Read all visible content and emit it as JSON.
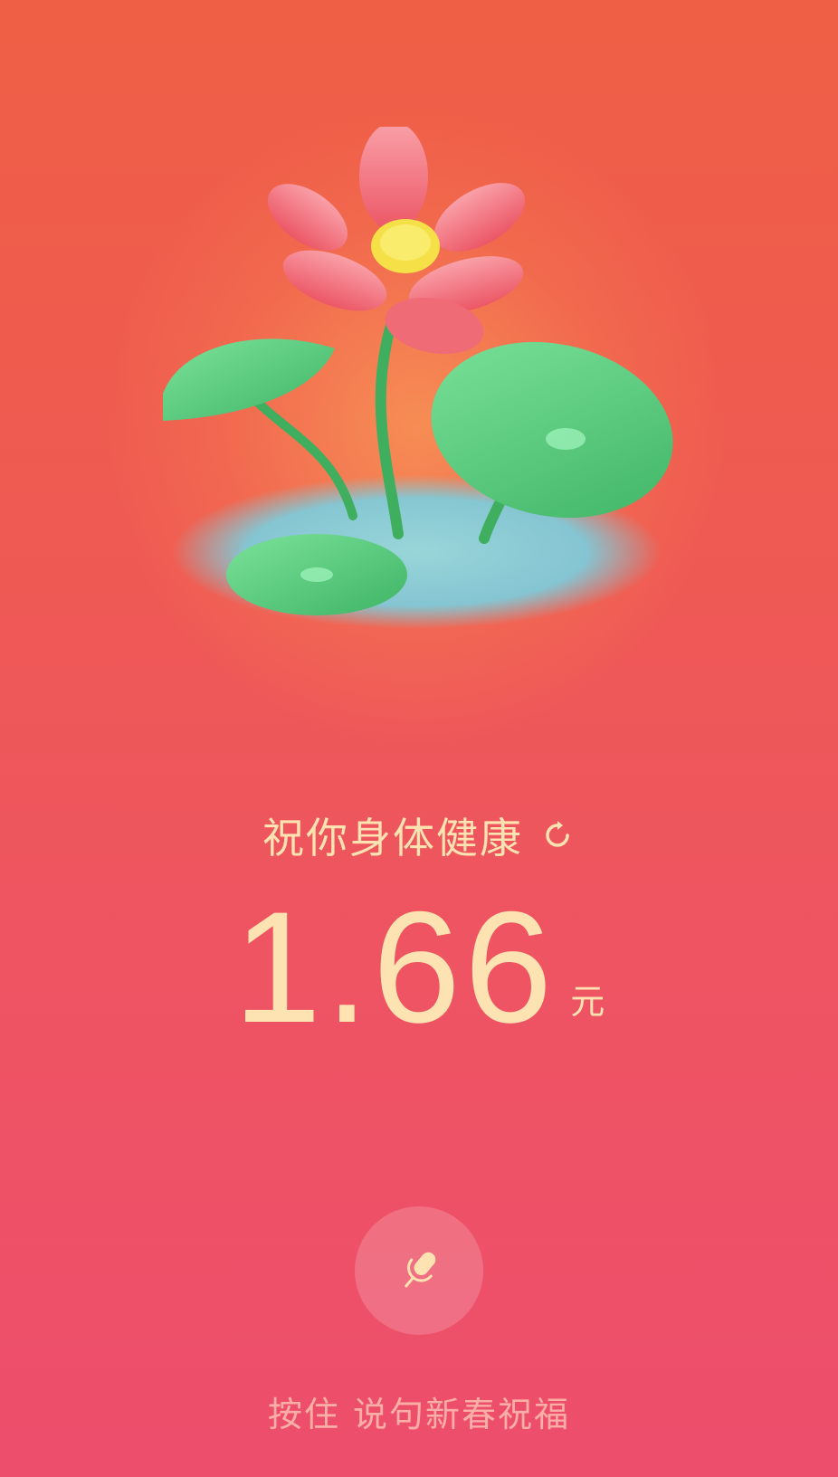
{
  "blessing": {
    "text": "祝你身体健康",
    "refresh_icon": "refresh-icon"
  },
  "amount": {
    "value": "1.66",
    "currency": "元"
  },
  "voice": {
    "icon": "microphone-icon",
    "hint": "按住 说句新春祝福"
  },
  "colors": {
    "background_top": "#ef5f45",
    "background_bottom": "#ed4e6c",
    "text_gold": "#fde3b2",
    "leaf_green": "#4fc57a",
    "petal_pink": "#f06b78",
    "water_blue": "#7fd4e0"
  }
}
